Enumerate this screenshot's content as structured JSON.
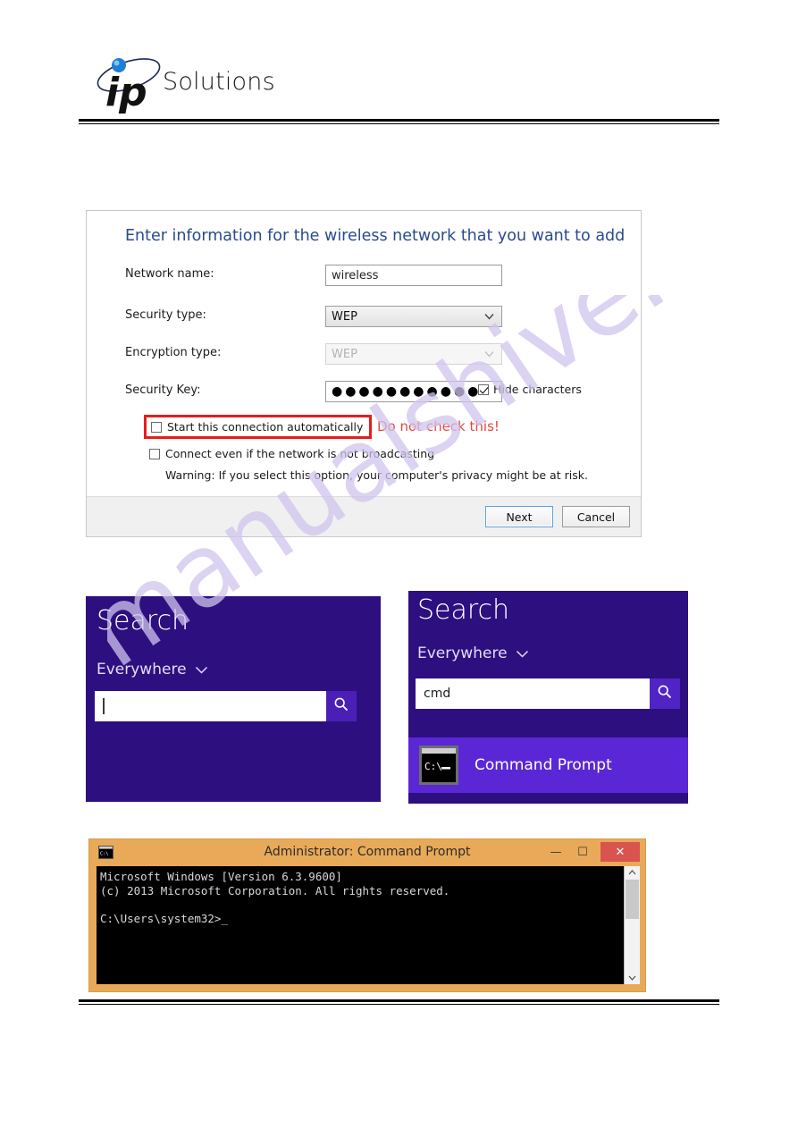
{
  "header": {
    "logo_text": "Solutions",
    "logo_mark": "ip-logo-icon"
  },
  "watermark": {
    "text": "manualshive.com",
    "color": "#cfc4ec"
  },
  "wireless_dialog": {
    "heading": "Enter information for the wireless network that you want to add",
    "fields": [
      {
        "label": "Network name:",
        "value": "wireless",
        "type": "text"
      },
      {
        "label": "Security type:",
        "value": "WEP",
        "type": "select"
      },
      {
        "label": "Encryption type:",
        "value": "WEP",
        "type": "select-disabled"
      },
      {
        "label": "Security Key:",
        "value": "●●●●●●●●●●●",
        "type": "password"
      }
    ],
    "hide_characters": {
      "label": "Hide characters",
      "checked": true
    },
    "start_automatically": {
      "label": "Start this connection automatically",
      "checked": false,
      "highlight_color": "#e81c1c"
    },
    "annotation": {
      "text": "Do not check this!",
      "color": "#e8453c"
    },
    "connect_not_broadcasting": {
      "label": "Connect even if the network is not broadcasting",
      "checked": false
    },
    "warning": "Warning: If you select this option, your computer's privacy might be at risk.",
    "buttons": {
      "next": "Next",
      "cancel": "Cancel"
    }
  },
  "search_empty": {
    "title": "Search",
    "scope": "Everywhere",
    "query": "",
    "search_icon": "magnifier-icon",
    "background": "#2d0f80"
  },
  "search_cmd": {
    "title": "Search",
    "scope": "Everywhere",
    "query": "cmd",
    "search_icon": "magnifier-icon",
    "result": {
      "label": "Command Prompt",
      "icon": "console-icon"
    },
    "background": "#2d0f80",
    "result_background": "#5b27d6"
  },
  "command_prompt": {
    "title": "Administrator: Command Prompt",
    "icon": "console-icon",
    "controls": {
      "minimize": "—",
      "maximize": "☐",
      "close": "✕"
    },
    "console_text": "Microsoft Windows [Version 6.3.9600]\n(c) 2013 Microsoft Corporation. All rights reserved.\n\nC:\\Users\\system32>_",
    "frame_color": "#e8aa59",
    "close_color": "#d9534f"
  }
}
